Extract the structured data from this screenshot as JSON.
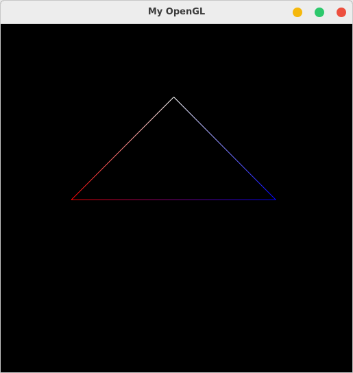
{
  "window": {
    "title": "My OpenGL",
    "buttons": {
      "minimize": {
        "color": "#f5b80c"
      },
      "maximize": {
        "color": "#2dc86c"
      },
      "close": {
        "color": "#ed4f3e"
      }
    }
  },
  "viewport": {
    "background": "#000000",
    "primitive": "triangle-outline",
    "vertex_colors": {
      "apex": "#ffffff",
      "bottom_left": "#ff0000",
      "bottom_right": "#0000ff"
    }
  }
}
